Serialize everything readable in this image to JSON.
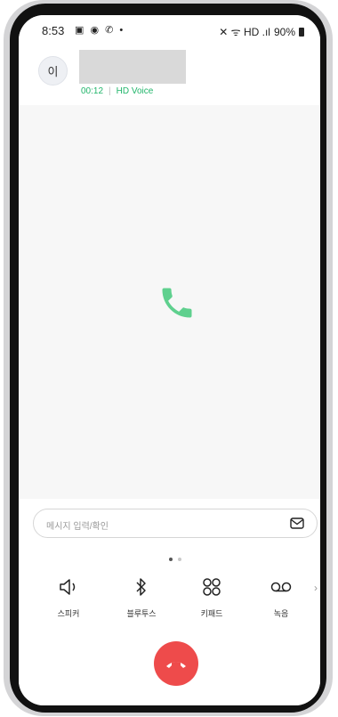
{
  "status_bar": {
    "time": "8:53",
    "left_icons": "▣ ◉ ✆ •",
    "right_icons": "✕ ᯤ HD .ıl",
    "battery": "90%"
  },
  "caller": {
    "avatar_initial": "이",
    "duration": "00:12",
    "separator": "|",
    "voice_type": "HD Voice"
  },
  "message": {
    "placeholder": "메시지 입력/확인"
  },
  "actions": [
    {
      "icon": "speaker-icon",
      "label": "스피커"
    },
    {
      "icon": "bluetooth-icon",
      "label": "블루투스"
    },
    {
      "icon": "keypad-icon",
      "label": "키패드"
    },
    {
      "icon": "voicemail-record-icon",
      "label": "녹음"
    }
  ],
  "more_chevron": "›",
  "colors": {
    "accent_green": "#21b56a",
    "end_call_red": "#ee4b4b"
  }
}
